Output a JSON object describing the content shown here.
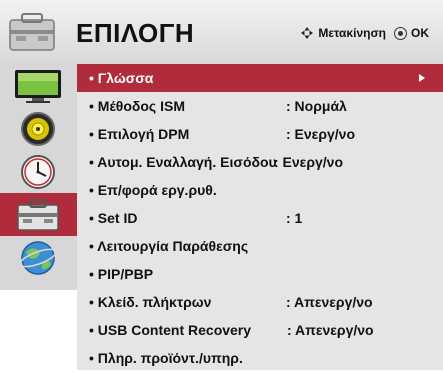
{
  "header": {
    "title": "ΕΠΙΛΟΓΗ",
    "icon": "settings-toolbox-icon",
    "nav_hint": "Μετακίνηση",
    "ok_hint": "OK"
  },
  "sidebar": {
    "items": [
      {
        "icon": "picture-tv-icon"
      },
      {
        "icon": "audio-speaker-icon"
      },
      {
        "icon": "time-clock-icon"
      },
      {
        "icon": "option-toolbox-icon",
        "selected": true
      },
      {
        "icon": "network-globe-icon"
      }
    ]
  },
  "menu": {
    "items": [
      {
        "label": "• Γλώσσα",
        "value": "",
        "selected": true
      },
      {
        "label": "• Μέθοδος ISM",
        "value": ": Νορμάλ"
      },
      {
        "label": "• Επιλογή DPM",
        "value": ": Ενεργ/νο"
      },
      {
        "label": "• Αυτομ. Εναλλαγή. Εισόδου",
        "value": ": Ενεργ/νο"
      },
      {
        "label": "• Επ/φορά εργ.ρυθ.",
        "value": ""
      },
      {
        "label": "• Set ID",
        "value": ": 1"
      },
      {
        "label": "• Λειτουργία Παράθεσης",
        "value": ""
      },
      {
        "label": "• PIP/PBP",
        "value": ""
      },
      {
        "label": "• Κλείδ. πλήκτρων",
        "value": ": Απενεργ/νο"
      },
      {
        "label": "• USB Content Recovery",
        "value": ": Απενεργ/νο"
      },
      {
        "label": "• Πληρ. προϊόντ./υπηρ.",
        "value": ""
      }
    ]
  },
  "colors": {
    "accent": "#b02b3b",
    "menu_bg": "#e5e5e5",
    "sidebar_bg": "#d7d7d7"
  }
}
